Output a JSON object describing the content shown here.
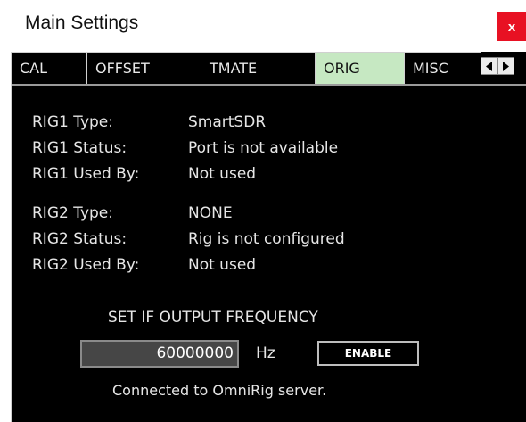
{
  "window": {
    "title": "Main Settings",
    "close_label": "x"
  },
  "tabs": [
    {
      "label": "CAL",
      "active": false
    },
    {
      "label": "OFFSET",
      "active": false
    },
    {
      "label": "TMATE",
      "active": false
    },
    {
      "label": "ORIG",
      "active": true
    },
    {
      "label": "MISC",
      "active": false
    }
  ],
  "rig_info": [
    {
      "label": "RIG1 Type:",
      "value": "SmartSDR"
    },
    {
      "label": "RIG1 Status:",
      "value": "Port is not available"
    },
    {
      "label": "RIG1 Used By:",
      "value": "Not used"
    },
    {
      "label": "RIG2 Type:",
      "value": "NONE"
    },
    {
      "label": "RIG2 Status:",
      "value": "Rig is not configured"
    },
    {
      "label": "RIG2 Used By:",
      "value": "Not used"
    }
  ],
  "if_output": {
    "title": "SET IF OUTPUT FREQUENCY",
    "value": "60000000",
    "unit": "Hz",
    "enable_label": "ENABLE"
  },
  "status_text": "Connected to OmniRig server.",
  "colors": {
    "active_tab": "#c6e8c2",
    "panel_bg": "#000000",
    "close_bg": "#e81123"
  }
}
